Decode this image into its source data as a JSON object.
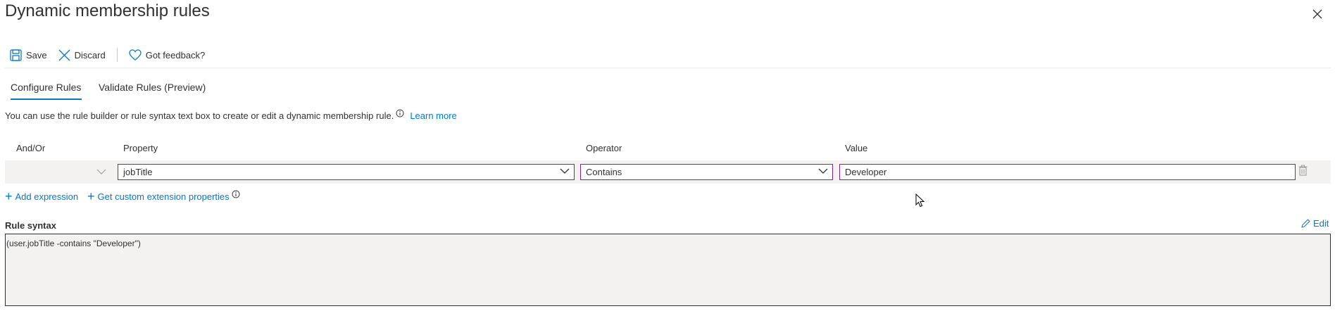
{
  "title": "Dynamic membership rules",
  "toolbar": {
    "save_label": "Save",
    "discard_label": "Discard",
    "feedback_label": "Got feedback?"
  },
  "tabs": [
    {
      "label": "Configure Rules",
      "active": true
    },
    {
      "label": "Validate Rules (Preview)",
      "active": false
    }
  ],
  "info": {
    "text": "You can use the rule builder or rule syntax text box to create or edit a dynamic membership rule.",
    "learn_more": "Learn more"
  },
  "columns": {
    "andor": "And/Or",
    "property": "Property",
    "operator": "Operator",
    "value": "Value"
  },
  "row": {
    "andor": "",
    "property": "jobTitle",
    "operator": "Contains",
    "value": "Developer"
  },
  "actions": {
    "add_expression": "Add expression",
    "get_custom": "Get custom extension properties"
  },
  "rule_syntax": {
    "label": "Rule syntax",
    "edit_label": "Edit",
    "text": "(user.jobTitle -contains \"Developer\")"
  },
  "colors": {
    "accent": "#0078d4",
    "field_border": "#8a2090",
    "row_bg": "#f3f2f1"
  }
}
